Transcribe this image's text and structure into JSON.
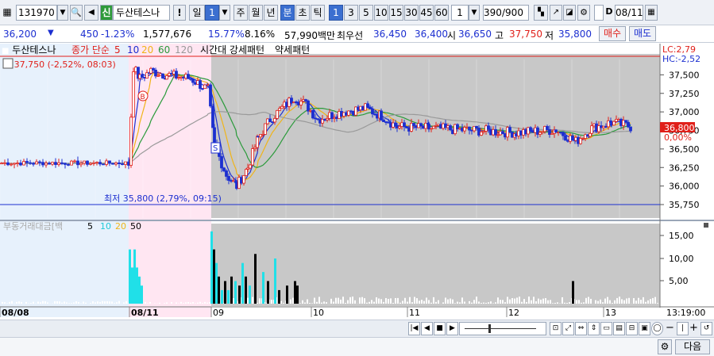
{
  "toolbar": {
    "code": "131970",
    "badge": "신",
    "name": "두산테스나",
    "excl": "!",
    "period_label": "일",
    "period_count": "1",
    "periods": [
      "주",
      "월",
      "년",
      "분",
      "초",
      "틱"
    ],
    "active_period": "분",
    "minutes": [
      "1",
      "3",
      "5",
      "10",
      "15",
      "30",
      "45",
      "60"
    ],
    "active_minute": "1",
    "count_value": "1",
    "page_current": "390",
    "page_total": "/900",
    "date": "08/11"
  },
  "info": {
    "price": "36,200",
    "arrow": "▼",
    "change": "450",
    "change_pct": "-1.23%",
    "volume": "1,577,676",
    "turnover": "15.77%",
    "ratio": "8.16%",
    "amount": "57,990백만",
    "best_bid_label": "최우선",
    "best_ask": "36,450",
    "best_bid": "36,400",
    "open_label": "시",
    "open": "36,650",
    "high_label": "고",
    "high": "37,750",
    "low_label": "저",
    "low": "35,800",
    "buy_button": "매수",
    "sell_button": "매도"
  },
  "legend": {
    "name": "두산테스나",
    "ma_label": "종가 단순",
    "ma5": "5",
    "ma10": "10",
    "ma20": "20",
    "ma60": "60",
    "ma120": "120",
    "pattern1": "시간대 강세패턴",
    "pattern2": "약세패턴"
  },
  "chart": {
    "high_annot": "고 37,750 (-2,52%, 08:03)",
    "low_annot": "최저 35,800 (2,79%, 09:15)",
    "lc": "LC:2,79",
    "hc": "HC:-2,52",
    "current_price": "36,800",
    "current_pct": "0,00%",
    "price_ticks": [
      "37,500",
      "37,250",
      "37,000",
      "36,750",
      "36,500",
      "36,250",
      "36,000",
      "35,750"
    ],
    "vol_legend": "부동거래대금[백",
    "vol5": "5",
    "vol10": "10",
    "vol20": "20",
    "vol50": "50",
    "vol_ticks": [
      "15,00",
      "10,00",
      "5,00"
    ],
    "x_labels": [
      "08/08",
      "08/11",
      "09",
      "10",
      "11",
      "12",
      "13"
    ],
    "time_label": "13:19:00",
    "marker_b": "B",
    "marker_s": "S"
  },
  "colors": {
    "up": "#e0201a",
    "down": "#1c2fd0",
    "ma5": "#1c2fd0",
    "ma10": "#f0b418",
    "ma20": "#2a9a3a",
    "ma60": "#2a9a3a",
    "ma120": "#9a9a9a",
    "vol_cyan": "#20e0e8",
    "premarket": "#ffe6f2",
    "prevday": "#e7f1fc",
    "regular": "#c8c8c8"
  },
  "footer": {
    "next_button": "다음",
    "zoom_minus": "−",
    "zoom_plus": "+"
  }
}
